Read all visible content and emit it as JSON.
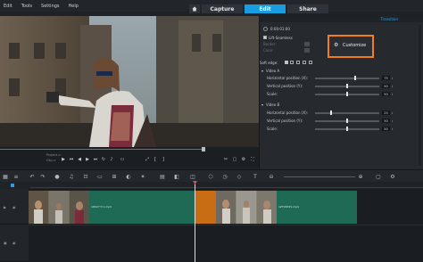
{
  "menu": {
    "items": [
      "Edit",
      "Tools",
      "Settings",
      "Help"
    ]
  },
  "tabs": {
    "home_icon": "home-icon",
    "items": [
      {
        "label": "Capture",
        "active": false
      },
      {
        "label": "Edit",
        "active": true
      },
      {
        "label": "Share",
        "active": false
      }
    ]
  },
  "preview": {
    "project_label": "Project->",
    "clip_label": "Clip->",
    "scrub_progress": 0.785
  },
  "panel": {
    "title": "Transition",
    "timecode": "0:00:01:00",
    "tilt_seamless": "Lift-Seamless",
    "border_label": "Border:",
    "color_label": "Color:",
    "soft_edge_label": "Soft edge:",
    "customize": "Customize",
    "video_a": {
      "label": "Video A",
      "rows": [
        {
          "label": "Horizontal position (X):",
          "value": "75",
          "level": 0.75
        },
        {
          "label": "Vertical position (Y):",
          "value": "50",
          "level": 0.5
        },
        {
          "label": "Scale:",
          "value": "50",
          "level": 0.5
        }
      ]
    },
    "video_b": {
      "label": "Video B",
      "rows": [
        {
          "label": "Horizontal position (X):",
          "value": "25",
          "level": 0.25
        },
        {
          "label": "Vertical position (Y):",
          "value": "50",
          "level": 0.5
        },
        {
          "label": "Scale:",
          "value": "50",
          "level": 0.5
        }
      ]
    }
  },
  "timeline": {
    "clip1_name": "1R627!!!1.mp4",
    "clip2_name": "1ZT9001S.mp4",
    "accent": "#1a9de0",
    "clip_color": "#1f6a55",
    "highlight_color": "#f07f1a"
  }
}
